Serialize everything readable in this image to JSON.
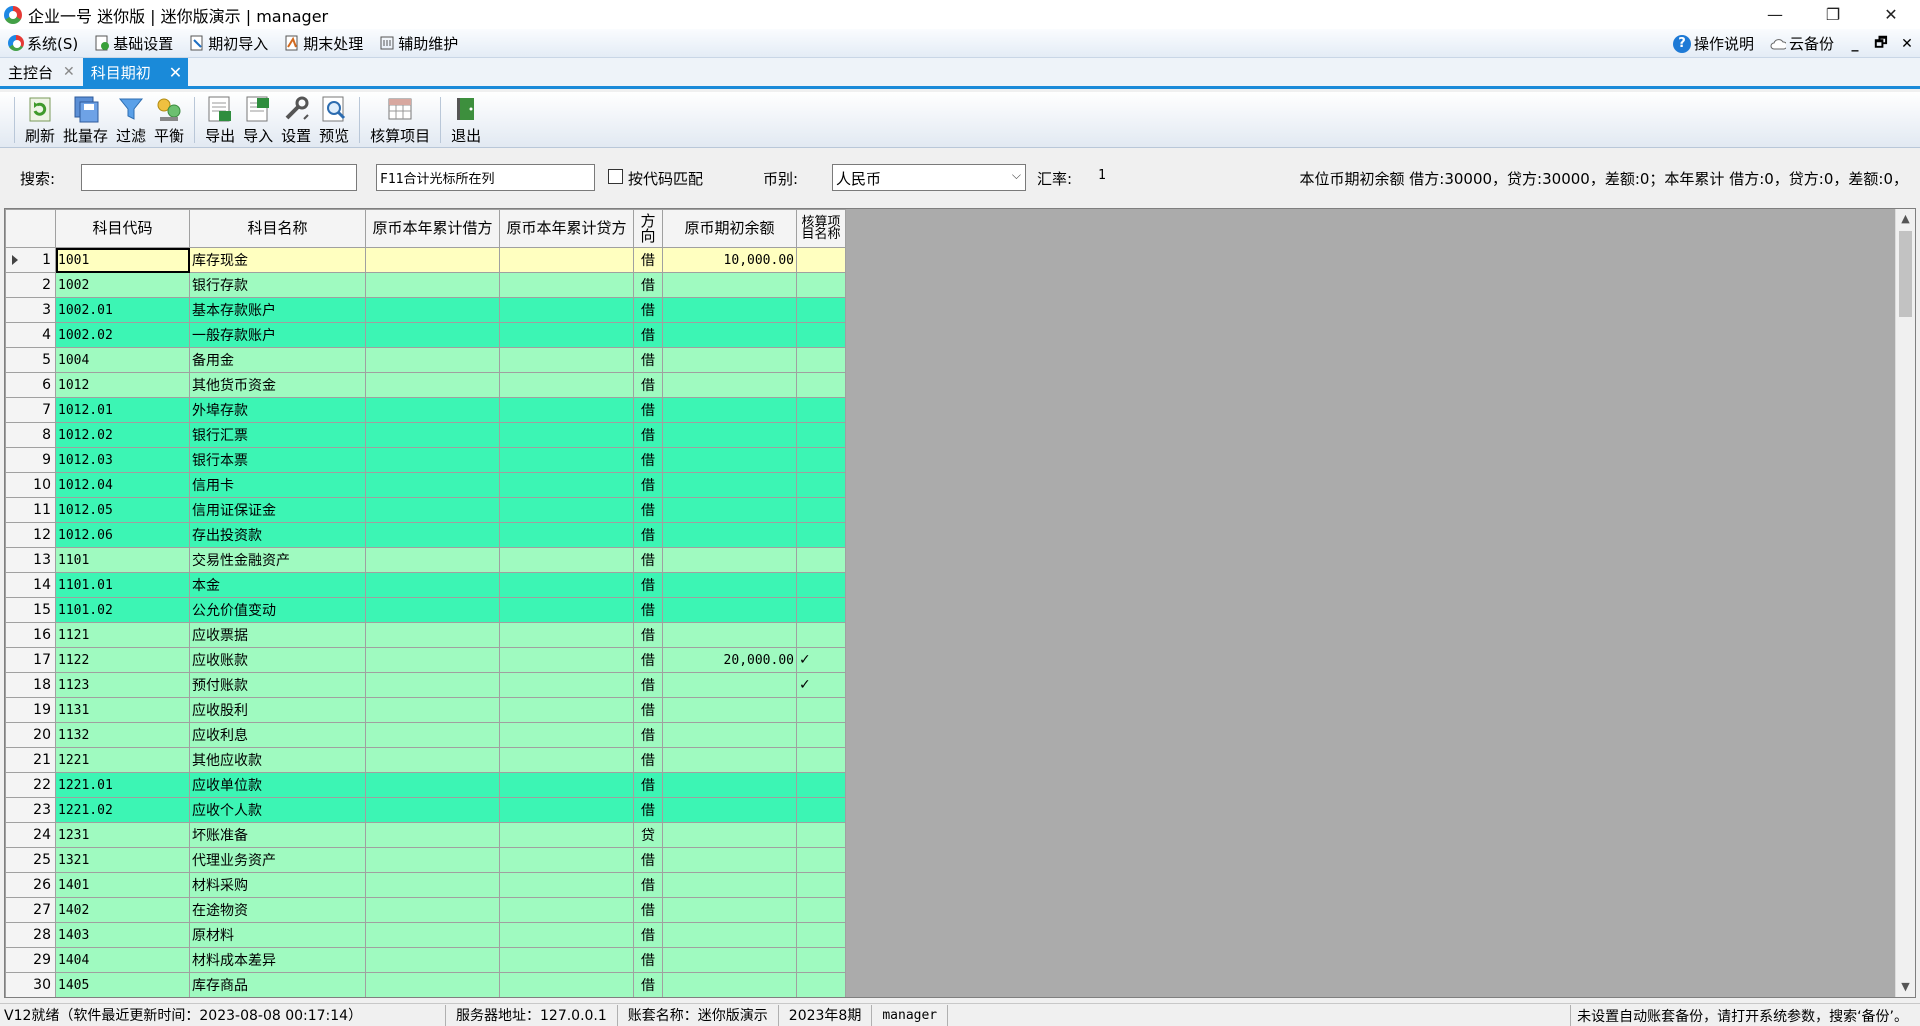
{
  "window": {
    "title": "企业一号 迷你版 | 迷你版演示 | manager",
    "minimize": "—",
    "restore": "❐",
    "close": "✕"
  },
  "menu": {
    "items": [
      {
        "label": "系统(S)",
        "icon": "app-logo-icon"
      },
      {
        "label": "基础设置",
        "icon": "settings-doc-icon"
      },
      {
        "label": "期初导入",
        "icon": "import-doc-icon"
      },
      {
        "label": "期末处理",
        "icon": "period-end-icon"
      },
      {
        "label": "辅助维护",
        "icon": "aux-maintain-icon"
      }
    ],
    "help": "操作说明",
    "cloud_backup": "云备份",
    "sys_min": "_",
    "sys_restore": "🗗",
    "sys_close": "✕"
  },
  "tabs": [
    {
      "label": "主控台",
      "active": false
    },
    {
      "label": "科目期初",
      "active": true
    }
  ],
  "toolbar": {
    "refresh": "刷新",
    "batch_save": "批量存",
    "filter": "过滤",
    "balance": "平衡",
    "export": "导出",
    "import": "导入",
    "settings": "设置",
    "preview": "预览",
    "audit_items": "核算项目",
    "exit": "退出"
  },
  "filter": {
    "search_label": "搜索:",
    "search_value": "",
    "column_hint": "F11合计光标所在列",
    "code_match_label": "按代码匹配",
    "code_match_checked": false,
    "currency_label": "币别:",
    "currency_value": "人民币",
    "rate_label": "汇率:",
    "rate_value": "1",
    "summary": "本位币期初余额 借方:30000，贷方:30000，差额:0；本年累计 借方:0，贷方:0，差额:0，"
  },
  "grid": {
    "headers": {
      "code": "科目代码",
      "name": "科目名称",
      "debit": "原币本年累计借方",
      "credit": "原币本年累计贷方",
      "direction": "方向",
      "balance": "原币期初余额",
      "audit": "核算项目名称"
    },
    "rows": [
      {
        "no": "1",
        "code": "1001",
        "name": "库存现金",
        "dir": "借",
        "balance": "10,000.00",
        "audit": "",
        "color": "#ffffc0",
        "current": true
      },
      {
        "no": "2",
        "code": "1002",
        "name": "银行存款",
        "dir": "借",
        "balance": "",
        "audit": "",
        "color": "#9ffac0"
      },
      {
        "no": "3",
        "code": "1002.01",
        "name": "基本存款账户",
        "dir": "借",
        "balance": "",
        "audit": "",
        "color": "#3cf5b4"
      },
      {
        "no": "4",
        "code": "1002.02",
        "name": "一般存款账户",
        "dir": "借",
        "balance": "",
        "audit": "",
        "color": "#3cf5b4"
      },
      {
        "no": "5",
        "code": "1004",
        "name": "备用金",
        "dir": "借",
        "balance": "",
        "audit": "",
        "color": "#9ffac0"
      },
      {
        "no": "6",
        "code": "1012",
        "name": "其他货币资金",
        "dir": "借",
        "balance": "",
        "audit": "",
        "color": "#9ffac0"
      },
      {
        "no": "7",
        "code": "1012.01",
        "name": "外埠存款",
        "dir": "借",
        "balance": "",
        "audit": "",
        "color": "#3cf5b4"
      },
      {
        "no": "8",
        "code": "1012.02",
        "name": "银行汇票",
        "dir": "借",
        "balance": "",
        "audit": "",
        "color": "#3cf5b4"
      },
      {
        "no": "9",
        "code": "1012.03",
        "name": "银行本票",
        "dir": "借",
        "balance": "",
        "audit": "",
        "color": "#3cf5b4"
      },
      {
        "no": "10",
        "code": "1012.04",
        "name": "信用卡",
        "dir": "借",
        "balance": "",
        "audit": "",
        "color": "#3cf5b4"
      },
      {
        "no": "11",
        "code": "1012.05",
        "name": "信用证保证金",
        "dir": "借",
        "balance": "",
        "audit": "",
        "color": "#3cf5b4"
      },
      {
        "no": "12",
        "code": "1012.06",
        "name": "存出投资款",
        "dir": "借",
        "balance": "",
        "audit": "",
        "color": "#3cf5b4"
      },
      {
        "no": "13",
        "code": "1101",
        "name": "交易性金融资产",
        "dir": "借",
        "balance": "",
        "audit": "",
        "color": "#9ffac0"
      },
      {
        "no": "14",
        "code": "1101.01",
        "name": "本金",
        "dir": "借",
        "balance": "",
        "audit": "",
        "color": "#3cf5b4"
      },
      {
        "no": "15",
        "code": "1101.02",
        "name": "公允价值变动",
        "dir": "借",
        "balance": "",
        "audit": "",
        "color": "#3cf5b4"
      },
      {
        "no": "16",
        "code": "1121",
        "name": "应收票据",
        "dir": "借",
        "balance": "",
        "audit": "",
        "color": "#9ffac0"
      },
      {
        "no": "17",
        "code": "1122",
        "name": "应收账款",
        "dir": "借",
        "balance": "20,000.00",
        "audit": "✓",
        "color": "#9ffac0"
      },
      {
        "no": "18",
        "code": "1123",
        "name": "预付账款",
        "dir": "借",
        "balance": "",
        "audit": "✓",
        "color": "#9ffac0"
      },
      {
        "no": "19",
        "code": "1131",
        "name": "应收股利",
        "dir": "借",
        "balance": "",
        "audit": "",
        "color": "#9ffac0"
      },
      {
        "no": "20",
        "code": "1132",
        "name": "应收利息",
        "dir": "借",
        "balance": "",
        "audit": "",
        "color": "#9ffac0"
      },
      {
        "no": "21",
        "code": "1221",
        "name": "其他应收款",
        "dir": "借",
        "balance": "",
        "audit": "",
        "color": "#9ffac0"
      },
      {
        "no": "22",
        "code": "1221.01",
        "name": "应收单位款",
        "dir": "借",
        "balance": "",
        "audit": "",
        "color": "#3cf5b4"
      },
      {
        "no": "23",
        "code": "1221.02",
        "name": "应收个人款",
        "dir": "借",
        "balance": "",
        "audit": "",
        "color": "#3cf5b4"
      },
      {
        "no": "24",
        "code": "1231",
        "name": "坏账准备",
        "dir": "贷",
        "balance": "",
        "audit": "",
        "color": "#9ffac0"
      },
      {
        "no": "25",
        "code": "1321",
        "name": "代理业务资产",
        "dir": "借",
        "balance": "",
        "audit": "",
        "color": "#9ffac0"
      },
      {
        "no": "26",
        "code": "1401",
        "name": "材料采购",
        "dir": "借",
        "balance": "",
        "audit": "",
        "color": "#9ffac0"
      },
      {
        "no": "27",
        "code": "1402",
        "name": "在途物资",
        "dir": "借",
        "balance": "",
        "audit": "",
        "color": "#9ffac0"
      },
      {
        "no": "28",
        "code": "1403",
        "name": "原材料",
        "dir": "借",
        "balance": "",
        "audit": "",
        "color": "#9ffac0"
      },
      {
        "no": "29",
        "code": "1404",
        "name": "材料成本差异",
        "dir": "借",
        "balance": "",
        "audit": "",
        "color": "#9ffac0"
      },
      {
        "no": "30",
        "code": "1405",
        "name": "库存商品",
        "dir": "借",
        "balance": "",
        "audit": "",
        "color": "#9ffac0"
      }
    ]
  },
  "status": {
    "version": "V12就绪（软件最近更新时间：2023-08-08 00:17:14）",
    "server": "服务器地址：127.0.0.1",
    "account_set": "账套名称：迷你版演示",
    "period": "2023年8期",
    "user": "manager",
    "backup_hint": "未设置自动账套备份，请打开系统参数，搜索‘备份’。"
  }
}
